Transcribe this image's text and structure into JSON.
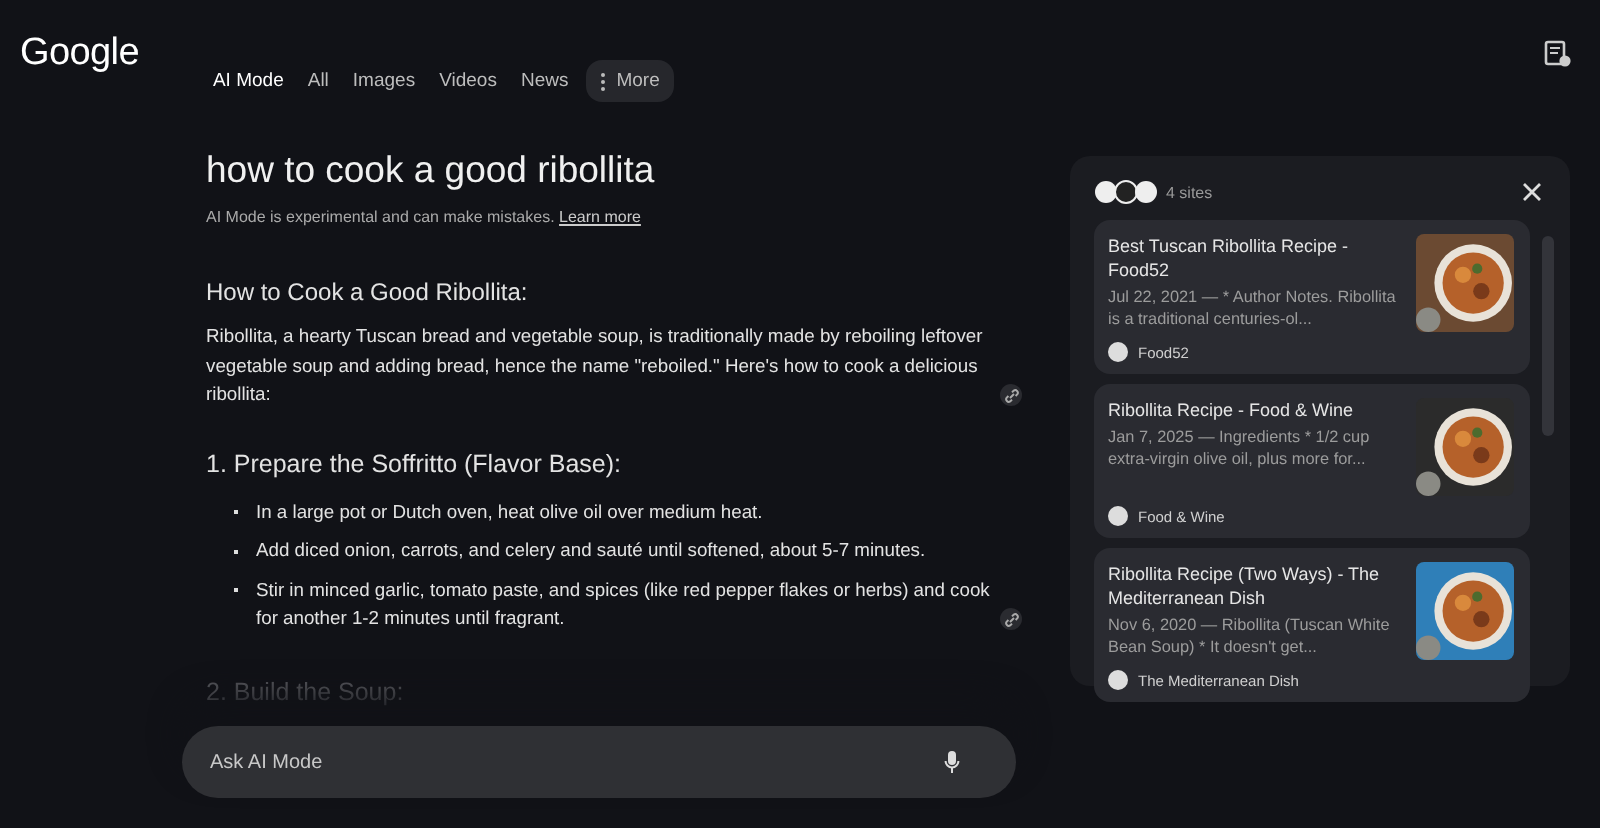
{
  "header": {
    "logo": "Google",
    "tabs": [
      {
        "label": "AI Mode",
        "selected": true
      },
      {
        "label": "All",
        "selected": false
      },
      {
        "label": "Images",
        "selected": false
      },
      {
        "label": "Videos",
        "selected": false
      },
      {
        "label": "News",
        "selected": false
      }
    ],
    "more": "More"
  },
  "query": "how to cook a good ribollita",
  "disclaimer": {
    "text": "AI Mode is experimental and can make mistakes.",
    "link": "Learn more"
  },
  "answer": {
    "heading": "How to Cook a Good Ribollita:",
    "intro": {
      "text": "Ribollita, a hearty Tuscan bread and vegetable soup, is traditionally made by reboiling leftover vegetable soup and adding bread, hence the name \"reboiled.\" Here's how to cook a delicious ribollita:",
      "citation": true
    },
    "sections": [
      {
        "title": "1. Prepare the Soffritto (Flavor Base):",
        "bullets": [
          {
            "text": "In a large pot or Dutch oven, heat olive oil over medium heat.",
            "citation": false
          },
          {
            "text": "Add diced onion, carrots, and celery and sauté until softened, about 5-7 minutes.",
            "citation": false
          },
          {
            "text": "Stir in minced garlic, tomato paste, and spices (like red pepper flakes or herbs) and cook for another 1-2 minutes until fragrant.",
            "citation": true
          }
        ]
      },
      {
        "title": "2. Build the Soup:"
      }
    ]
  },
  "sources": {
    "count": "4 sites",
    "items": [
      {
        "title": "Best Tuscan Ribollita Recipe - Food52",
        "snippet": "Jul 22, 2021 — * Author Notes. Ribollita is a traditional centuries-ol...",
        "site": "Food52",
        "kind": "picture"
      },
      {
        "title": "Ribollita Recipe - Food & Wine",
        "snippet": "Jan 7, 2025 — Ingredients * 1/2 cup extra-virgin olive oil, plus more for...",
        "site": "Food & Wine",
        "kind": "picture"
      },
      {
        "title": "Ribollita Recipe (Two Ways) - The Mediterranean Dish",
        "snippet": "Nov 6, 2020 — Ribollita (Tuscan White Bean Soup) * It doesn't get...",
        "site": "The Mediterranean Dish",
        "kind": "picture"
      }
    ]
  },
  "search": {
    "placeholder": "Ask AI Mode"
  }
}
